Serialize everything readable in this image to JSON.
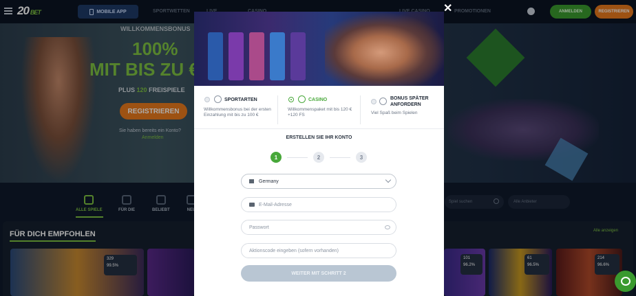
{
  "header": {
    "logo_text": "20",
    "logo_suffix": "BET",
    "mobile_app_label": "MOBILE APP",
    "nav_items": [
      "SPORTWETTEN",
      "LIVE",
      "CASINO",
      "LIVE CASINO",
      "PROMOTIONEN"
    ],
    "login_label": "ANMELDEN",
    "register_label": "REGISTRIEREN"
  },
  "hero": {
    "welcome": "WILLKOMMENSBONUS",
    "percent": "100%",
    "amount": "MIT BIS ZU €",
    "plus_prefix": "PLUS",
    "plus_number": "120",
    "plus_suffix": "FREISPIELE",
    "register_label": "REGISTRIEREN",
    "have_account": "Sie haben bereits ein Konto?",
    "login_link": "Anmelden"
  },
  "categories": [
    {
      "label": "ALLE SPIELE"
    },
    {
      "label": "FÜR DIE"
    },
    {
      "label": "BELIEBT"
    },
    {
      "label": "NEU"
    }
  ],
  "search": {
    "placeholder1": "Spiel suchen",
    "placeholder2": "Alle Anbieter"
  },
  "recommended": {
    "title": "FÜR DICH EMPFOHLEN",
    "show_all": "Alle anzeigen",
    "badge1": {
      "players": "329",
      "rtp": "99.5%"
    },
    "badge2": {
      "players": "101",
      "rtp": "96.2%"
    },
    "badge3": {
      "players": "61",
      "rtp": "96.5%"
    },
    "badge4": {
      "players": "214",
      "rtp": "96.6%"
    }
  },
  "modal": {
    "bonus_options": [
      {
        "title": "SPORTARTEN",
        "desc": "Willkommensbonus bei der ersten Einzahlung mit bis zu 100 €",
        "selected": false
      },
      {
        "title": "CASINO",
        "desc": "Willkommenspaket mit bis 120 € +120 FS",
        "selected": true
      },
      {
        "title": "BONUS SPÄTER ANFORDERN",
        "desc": "Viel Spaß beim Spielen",
        "selected": false
      }
    ],
    "create_account": "ERSTELLEN SIE IHR KONTO",
    "steps": [
      "1",
      "2",
      "3"
    ],
    "country_value": "Germany",
    "email_placeholder": "E-Mail-Adresse",
    "password_placeholder": "Passwort",
    "promo_placeholder": "Aktionscode eingeben (sofern vorhanden)",
    "submit_label": "WEITER MIT SCHRITT 2",
    "close": "✕"
  },
  "colors": {
    "accent_green": "#48a83a",
    "brand_orange": "#e87a1c",
    "dark_bg": "#0f1a2b"
  }
}
